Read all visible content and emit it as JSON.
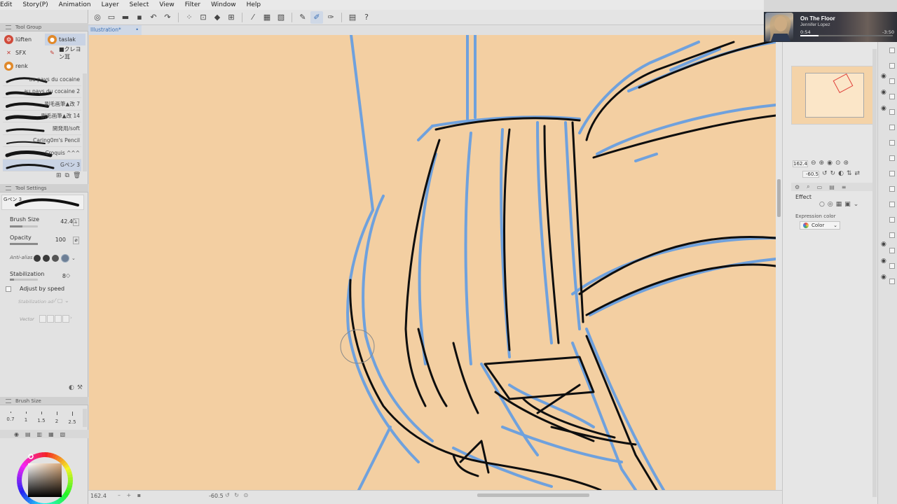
{
  "menu": [
    "Edit",
    "Story(P)",
    "Animation",
    "Layer",
    "Select",
    "View",
    "Filter",
    "Window",
    "Help"
  ],
  "document": {
    "tab_label": "Illustration*",
    "close_glyph": "•"
  },
  "tool_group": {
    "header": "Tool Group",
    "items": [
      {
        "label": "lüften",
        "icon": "gear-icon",
        "color": "#d04a3a",
        "selected": false
      },
      {
        "label": "taslak",
        "icon": "brush-icon",
        "color": "#e0892a",
        "selected": true
      },
      {
        "label": "SFX",
        "icon": "sfx-icon",
        "color": "#c23a32",
        "selected": false
      },
      {
        "label": "■クレヨン耳",
        "icon": "pen-icon",
        "color": "#c23a32",
        "selected": false
      },
      {
        "label": "renk",
        "icon": "palette-icon",
        "color": "#e0892a",
        "selected": false
      }
    ]
  },
  "brushes": [
    {
      "label": "au pays du cocaine"
    },
    {
      "label": "au pays du cocaine 2"
    },
    {
      "label": "刷毛画筆▲改 7"
    },
    {
      "label": "刷毛画筆▲改 14"
    },
    {
      "label": "開発用/soft"
    },
    {
      "label": "Caring0m's Pencil"
    },
    {
      "label": "Croquis ^^^"
    },
    {
      "label": "Gペン 3"
    }
  ],
  "tool_settings": {
    "header": "Tool Settings",
    "brush_name": "Gペン 3",
    "brush_size_label": "Brush Size",
    "brush_size_value": "42.4",
    "opacity_label": "Opacity",
    "opacity_value": "100",
    "antialias_label": "Anti-alias",
    "stabilization_label": "Stabilization",
    "stabilization_value": "8",
    "adjust_speed_label": "Adjust by speed",
    "stab_sub_label": "Stabilization ad",
    "vector_label": "Vector"
  },
  "brush_size_palette": {
    "header": "Brush Size",
    "sizes": [
      "0.7",
      "1",
      "1.5",
      "2",
      "2.5"
    ]
  },
  "status": {
    "zoom": "162.4",
    "rotation": "-60.5"
  },
  "navigator": {
    "zoom": "162.4",
    "rotation": "-60.5"
  },
  "sub_tool_detail": {
    "effect_label": "Effect",
    "expression_color_label": "Expression color",
    "color_option": "Color"
  },
  "media": {
    "title": "On The Floor",
    "artist": "Jennifer Lopez",
    "elapsed": "0:54",
    "remaining": "-3:50",
    "progress": 0.2
  },
  "colors": {
    "canvas": "#f3cfa2",
    "blue_line": "#6fa1dd",
    "black_line": "#0e0e0e",
    "selection": "#c9d3e4"
  }
}
